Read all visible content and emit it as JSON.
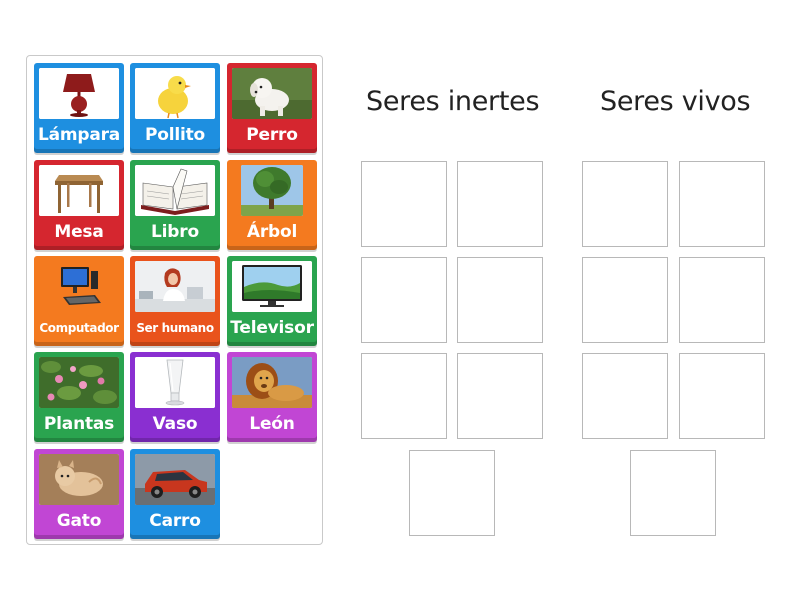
{
  "colors": {
    "blue": "#1e8fe0",
    "red": "#d5262f",
    "green": "#2aa44f",
    "orange": "#f47a1f",
    "orange_red": "#e9531c",
    "purple": "#8a2fd1",
    "magenta": "#c146d4",
    "slot_border": "#b8b8b8"
  },
  "cards": [
    {
      "label": "Lámpara",
      "icon": "lamp-icon",
      "color": "#1e8fe0"
    },
    {
      "label": "Pollito",
      "icon": "chick-icon",
      "color": "#1e8fe0"
    },
    {
      "label": "Perro",
      "icon": "dog-icon",
      "color": "#d5262f"
    },
    {
      "label": "Mesa",
      "icon": "table-icon",
      "color": "#d5262f"
    },
    {
      "label": "Libro",
      "icon": "book-icon",
      "color": "#2aa44f"
    },
    {
      "label": "Árbol",
      "icon": "tree-icon",
      "color": "#f47a1f"
    },
    {
      "label": "Computador",
      "icon": "computer-icon",
      "color": "#f47a1f"
    },
    {
      "label": "Ser humano",
      "icon": "human-icon",
      "color": "#e9531c"
    },
    {
      "label": "Televisor",
      "icon": "television-icon",
      "color": "#2aa44f"
    },
    {
      "label": "Plantas",
      "icon": "plants-icon",
      "color": "#2aa44f"
    },
    {
      "label": "Vaso",
      "icon": "glass-icon",
      "color": "#8a2fd1"
    },
    {
      "label": "León",
      "icon": "lion-icon",
      "color": "#c146d4"
    },
    {
      "label": "Gato",
      "icon": "cat-icon",
      "color": "#c146d4"
    },
    {
      "label": "Carro",
      "icon": "car-icon",
      "color": "#1e8fe0"
    }
  ],
  "columns": {
    "inertes": {
      "title": "Seres inertes",
      "slot_count": 7
    },
    "vivos": {
      "title": "Seres vivos",
      "slot_count": 7
    }
  }
}
